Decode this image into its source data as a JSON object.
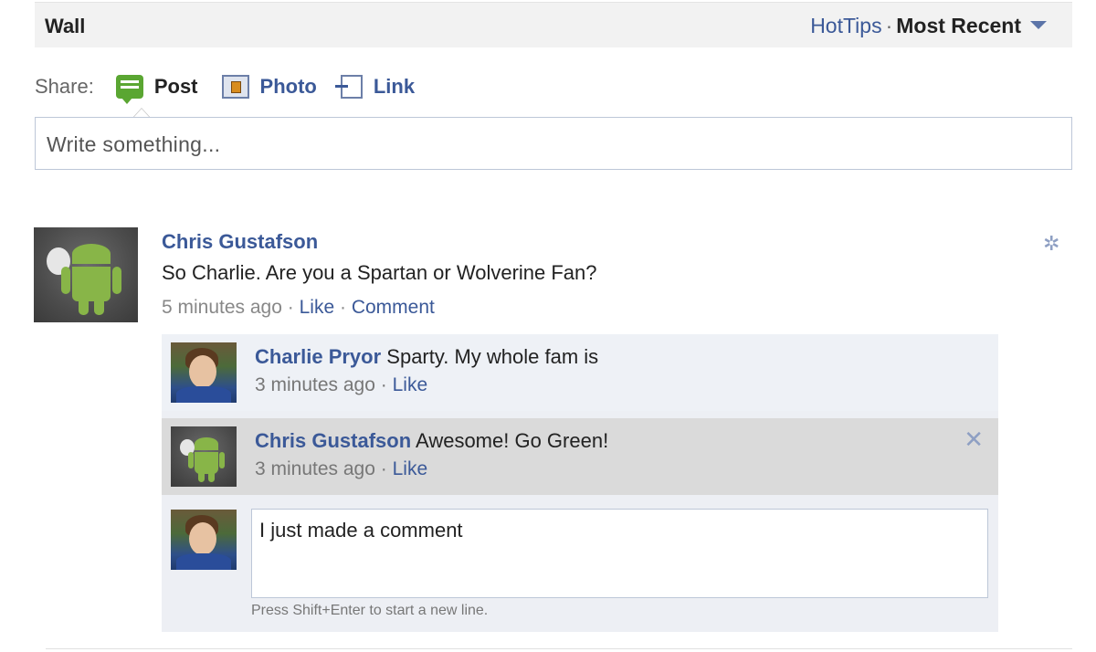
{
  "wall": {
    "title": "Wall",
    "filter_hottips": "HotTips",
    "filter_sep": "·",
    "filter_recent": "Most Recent"
  },
  "share": {
    "label": "Share:",
    "post": "Post",
    "photo": "Photo",
    "link": "Link"
  },
  "composer": {
    "placeholder": "Write something..."
  },
  "post": {
    "author": "Chris Gustafson",
    "text": "So Charlie. Are you a Spartan or Wolverine Fan?",
    "time": "5 minutes ago",
    "sep": "·",
    "like": "Like",
    "comment": "Comment"
  },
  "comments": [
    {
      "author": "Charlie Pryor",
      "text": " Sparty. My whole fam is",
      "time": "3 minutes ago",
      "sep": " · ",
      "like": "Like"
    },
    {
      "author": "Chris Gustafson",
      "text": " Awesome! Go Green!",
      "time": "3 minutes ago",
      "sep": " · ",
      "like": "Like",
      "remove": "✕"
    }
  ],
  "reply": {
    "value": "I just made a comment",
    "hint": "Press Shift+Enter to start a new line."
  },
  "icons": {
    "gear": "gear-icon",
    "close": "close-icon"
  },
  "colors": {
    "link": "#3b5998",
    "muted": "#888888",
    "comment_bg": "#edeff4",
    "highlight_bg": "#dadada"
  }
}
